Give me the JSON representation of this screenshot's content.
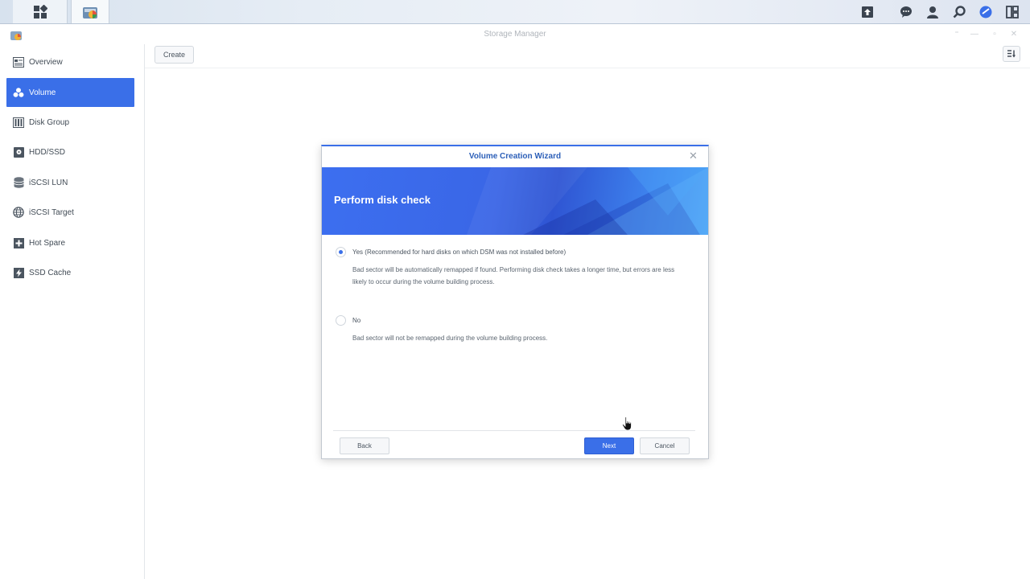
{
  "window": {
    "title": "Storage Manager"
  },
  "toolbar": {
    "create_label": "Create"
  },
  "sidebar": {
    "items": [
      {
        "label": "Overview",
        "icon": "overview-icon"
      },
      {
        "label": "Volume",
        "icon": "volume-icon",
        "active": true
      },
      {
        "label": "Disk Group",
        "icon": "disk-group-icon"
      },
      {
        "label": "HDD/SSD",
        "icon": "hdd-icon"
      },
      {
        "label": "iSCSI LUN",
        "icon": "iscsi-lun-icon"
      },
      {
        "label": "iSCSI Target",
        "icon": "globe-icon"
      },
      {
        "label": "Hot Spare",
        "icon": "plus-icon"
      },
      {
        "label": "SSD Cache",
        "icon": "flash-icon"
      }
    ]
  },
  "dialog": {
    "title": "Volume Creation Wizard",
    "banner_title": "Perform disk check",
    "options": [
      {
        "label": "Yes (Recommended for hard disks on which DSM was not installed before)",
        "description": "Bad sector will be automatically remapped if found. Performing disk check takes a longer time, but errors are less likely to occur during the volume building process.",
        "selected": true
      },
      {
        "label": "No",
        "description": "Bad sector will not be remapped during the volume building process.",
        "selected": false
      }
    ],
    "back_label": "Back",
    "next_label": "Next",
    "cancel_label": "Cancel"
  },
  "colors": {
    "accent": "#3a6fe8",
    "dialog_title": "#2c5fb8"
  }
}
